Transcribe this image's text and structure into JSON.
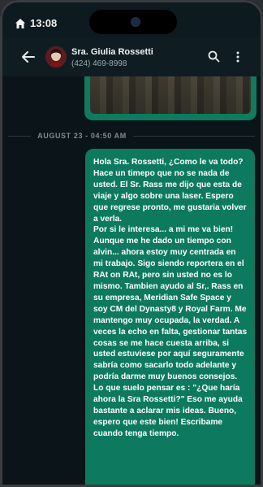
{
  "status_bar": {
    "time": "13:08"
  },
  "header": {
    "contact_name": "Sra. Giulia Rossetti",
    "contact_phone": "(424) 469-8998"
  },
  "chat": {
    "date_divider": "AUGUST 23 - 04:50 AM",
    "message_text": "Hola Sra. Rossetti, ¿Como le va todo? Hace un timepo que no se nada de usted. El Sr. Rass me dijo que esta de viaje y algo sobre una laser. Espero que regrese pronto, me gustaria volver a verla.\nPor si le interesa... a mi me va bien! Aunque me he dado un tiempo con alvin... ahora estoy muy centrada en mi trabajo. Sigo siendo reportera en el RAt on RAt, pero sin usted no es lo mismo. Tambien ayudo al Sr,. Rass en su empresa, Meridian Safe Space y soy CM del Dynasty8 y Royal Farm. Me mantengo muy ocupada, la verdad. A veces la echo en falta, gestionar tantas cosas se me hace cuesta arriba, si usted estuviese por aquí seguramente sabría como sacarlo todo adelante y podría darme muy buenos consejos.\nLo que suelo pensar es : \"¿Que haría ahora la Sra Rossetti?\" Eso me ayuda bastante a aclarar mis ideas. Bueno, espero que este bien! Escribame cuando tenga tiempo."
  },
  "colors": {
    "bubble": "#0d7a5f",
    "background": "#0b1418",
    "app_bar": "#0f1d22"
  }
}
